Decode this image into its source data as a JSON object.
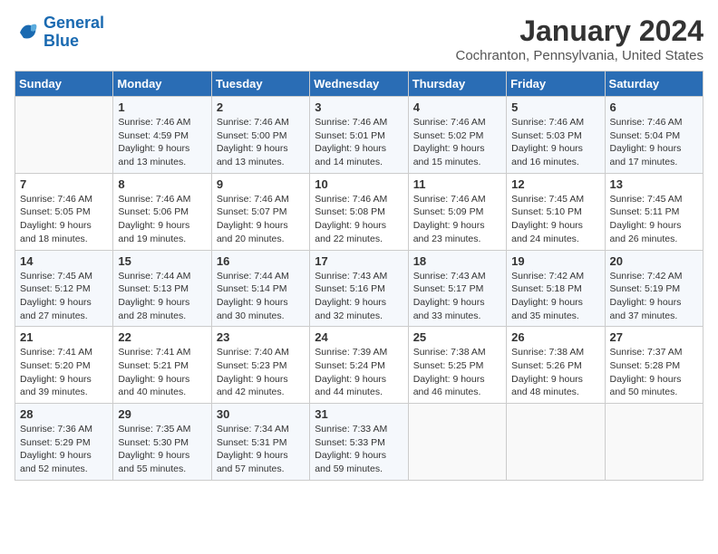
{
  "logo": {
    "line1": "General",
    "line2": "Blue"
  },
  "title": "January 2024",
  "subtitle": "Cochranton, Pennsylvania, United States",
  "days_of_week": [
    "Sunday",
    "Monday",
    "Tuesday",
    "Wednesday",
    "Thursday",
    "Friday",
    "Saturday"
  ],
  "weeks": [
    [
      {
        "num": "",
        "detail": ""
      },
      {
        "num": "1",
        "detail": "Sunrise: 7:46 AM\nSunset: 4:59 PM\nDaylight: 9 hours\nand 13 minutes."
      },
      {
        "num": "2",
        "detail": "Sunrise: 7:46 AM\nSunset: 5:00 PM\nDaylight: 9 hours\nand 13 minutes."
      },
      {
        "num": "3",
        "detail": "Sunrise: 7:46 AM\nSunset: 5:01 PM\nDaylight: 9 hours\nand 14 minutes."
      },
      {
        "num": "4",
        "detail": "Sunrise: 7:46 AM\nSunset: 5:02 PM\nDaylight: 9 hours\nand 15 minutes."
      },
      {
        "num": "5",
        "detail": "Sunrise: 7:46 AM\nSunset: 5:03 PM\nDaylight: 9 hours\nand 16 minutes."
      },
      {
        "num": "6",
        "detail": "Sunrise: 7:46 AM\nSunset: 5:04 PM\nDaylight: 9 hours\nand 17 minutes."
      }
    ],
    [
      {
        "num": "7",
        "detail": "Sunrise: 7:46 AM\nSunset: 5:05 PM\nDaylight: 9 hours\nand 18 minutes."
      },
      {
        "num": "8",
        "detail": "Sunrise: 7:46 AM\nSunset: 5:06 PM\nDaylight: 9 hours\nand 19 minutes."
      },
      {
        "num": "9",
        "detail": "Sunrise: 7:46 AM\nSunset: 5:07 PM\nDaylight: 9 hours\nand 20 minutes."
      },
      {
        "num": "10",
        "detail": "Sunrise: 7:46 AM\nSunset: 5:08 PM\nDaylight: 9 hours\nand 22 minutes."
      },
      {
        "num": "11",
        "detail": "Sunrise: 7:46 AM\nSunset: 5:09 PM\nDaylight: 9 hours\nand 23 minutes."
      },
      {
        "num": "12",
        "detail": "Sunrise: 7:45 AM\nSunset: 5:10 PM\nDaylight: 9 hours\nand 24 minutes."
      },
      {
        "num": "13",
        "detail": "Sunrise: 7:45 AM\nSunset: 5:11 PM\nDaylight: 9 hours\nand 26 minutes."
      }
    ],
    [
      {
        "num": "14",
        "detail": "Sunrise: 7:45 AM\nSunset: 5:12 PM\nDaylight: 9 hours\nand 27 minutes."
      },
      {
        "num": "15",
        "detail": "Sunrise: 7:44 AM\nSunset: 5:13 PM\nDaylight: 9 hours\nand 28 minutes."
      },
      {
        "num": "16",
        "detail": "Sunrise: 7:44 AM\nSunset: 5:14 PM\nDaylight: 9 hours\nand 30 minutes."
      },
      {
        "num": "17",
        "detail": "Sunrise: 7:43 AM\nSunset: 5:16 PM\nDaylight: 9 hours\nand 32 minutes."
      },
      {
        "num": "18",
        "detail": "Sunrise: 7:43 AM\nSunset: 5:17 PM\nDaylight: 9 hours\nand 33 minutes."
      },
      {
        "num": "19",
        "detail": "Sunrise: 7:42 AM\nSunset: 5:18 PM\nDaylight: 9 hours\nand 35 minutes."
      },
      {
        "num": "20",
        "detail": "Sunrise: 7:42 AM\nSunset: 5:19 PM\nDaylight: 9 hours\nand 37 minutes."
      }
    ],
    [
      {
        "num": "21",
        "detail": "Sunrise: 7:41 AM\nSunset: 5:20 PM\nDaylight: 9 hours\nand 39 minutes."
      },
      {
        "num": "22",
        "detail": "Sunrise: 7:41 AM\nSunset: 5:21 PM\nDaylight: 9 hours\nand 40 minutes."
      },
      {
        "num": "23",
        "detail": "Sunrise: 7:40 AM\nSunset: 5:23 PM\nDaylight: 9 hours\nand 42 minutes."
      },
      {
        "num": "24",
        "detail": "Sunrise: 7:39 AM\nSunset: 5:24 PM\nDaylight: 9 hours\nand 44 minutes."
      },
      {
        "num": "25",
        "detail": "Sunrise: 7:38 AM\nSunset: 5:25 PM\nDaylight: 9 hours\nand 46 minutes."
      },
      {
        "num": "26",
        "detail": "Sunrise: 7:38 AM\nSunset: 5:26 PM\nDaylight: 9 hours\nand 48 minutes."
      },
      {
        "num": "27",
        "detail": "Sunrise: 7:37 AM\nSunset: 5:28 PM\nDaylight: 9 hours\nand 50 minutes."
      }
    ],
    [
      {
        "num": "28",
        "detail": "Sunrise: 7:36 AM\nSunset: 5:29 PM\nDaylight: 9 hours\nand 52 minutes."
      },
      {
        "num": "29",
        "detail": "Sunrise: 7:35 AM\nSunset: 5:30 PM\nDaylight: 9 hours\nand 55 minutes."
      },
      {
        "num": "30",
        "detail": "Sunrise: 7:34 AM\nSunset: 5:31 PM\nDaylight: 9 hours\nand 57 minutes."
      },
      {
        "num": "31",
        "detail": "Sunrise: 7:33 AM\nSunset: 5:33 PM\nDaylight: 9 hours\nand 59 minutes."
      },
      {
        "num": "",
        "detail": ""
      },
      {
        "num": "",
        "detail": ""
      },
      {
        "num": "",
        "detail": ""
      }
    ]
  ]
}
